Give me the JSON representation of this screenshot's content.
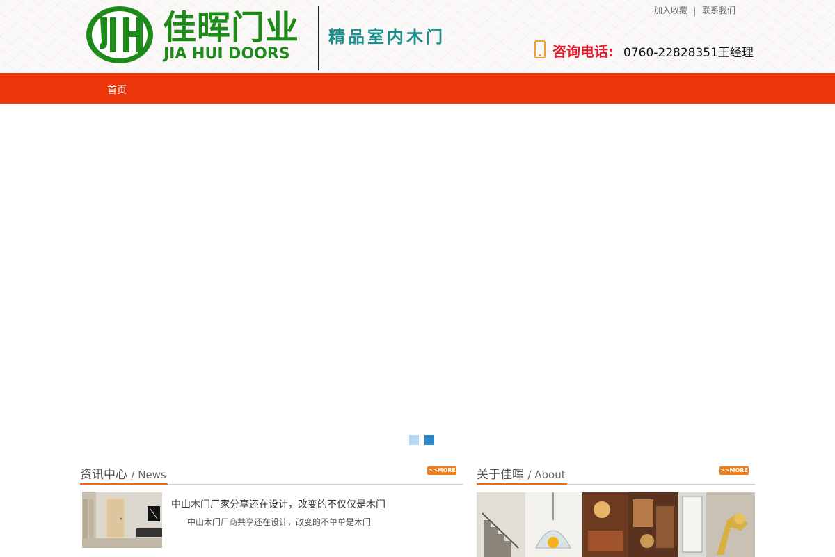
{
  "header": {
    "logo_cn": "佳晖门业",
    "logo_en": "JIA HUI DOORS",
    "logo_mark": "JH",
    "slogan": "精品室内木门",
    "top_links": {
      "favorite": "加入收藏",
      "contact": "联系我们"
    },
    "phone_label": "咨询电话:",
    "phone_number": "0760-22828351王经理",
    "phone_icon": "mobile-phone-icon"
  },
  "nav": {
    "items": [
      {
        "label": "首页"
      }
    ]
  },
  "banner": {
    "active_slide": 2,
    "slide_count": 2
  },
  "news": {
    "title_cn": "资讯中心",
    "title_en": "/ News",
    "more": ">>MORE",
    "items": [
      {
        "title": "中山木门厂家分享还在设计，改变的不仅仅是木门",
        "desc": "中山木门厂商共享还在设计，改变的不单单是木门"
      }
    ]
  },
  "about": {
    "title_cn": "关于佳晖",
    "title_en": "/ About",
    "more": ">>MORE"
  },
  "colors": {
    "brand_green": "#1d8a1a",
    "nav_red": "#ee360b",
    "accent_orange": "#ee6a1c",
    "phone_red": "#e8192c",
    "slogan_teal": "#1b8f8b"
  }
}
